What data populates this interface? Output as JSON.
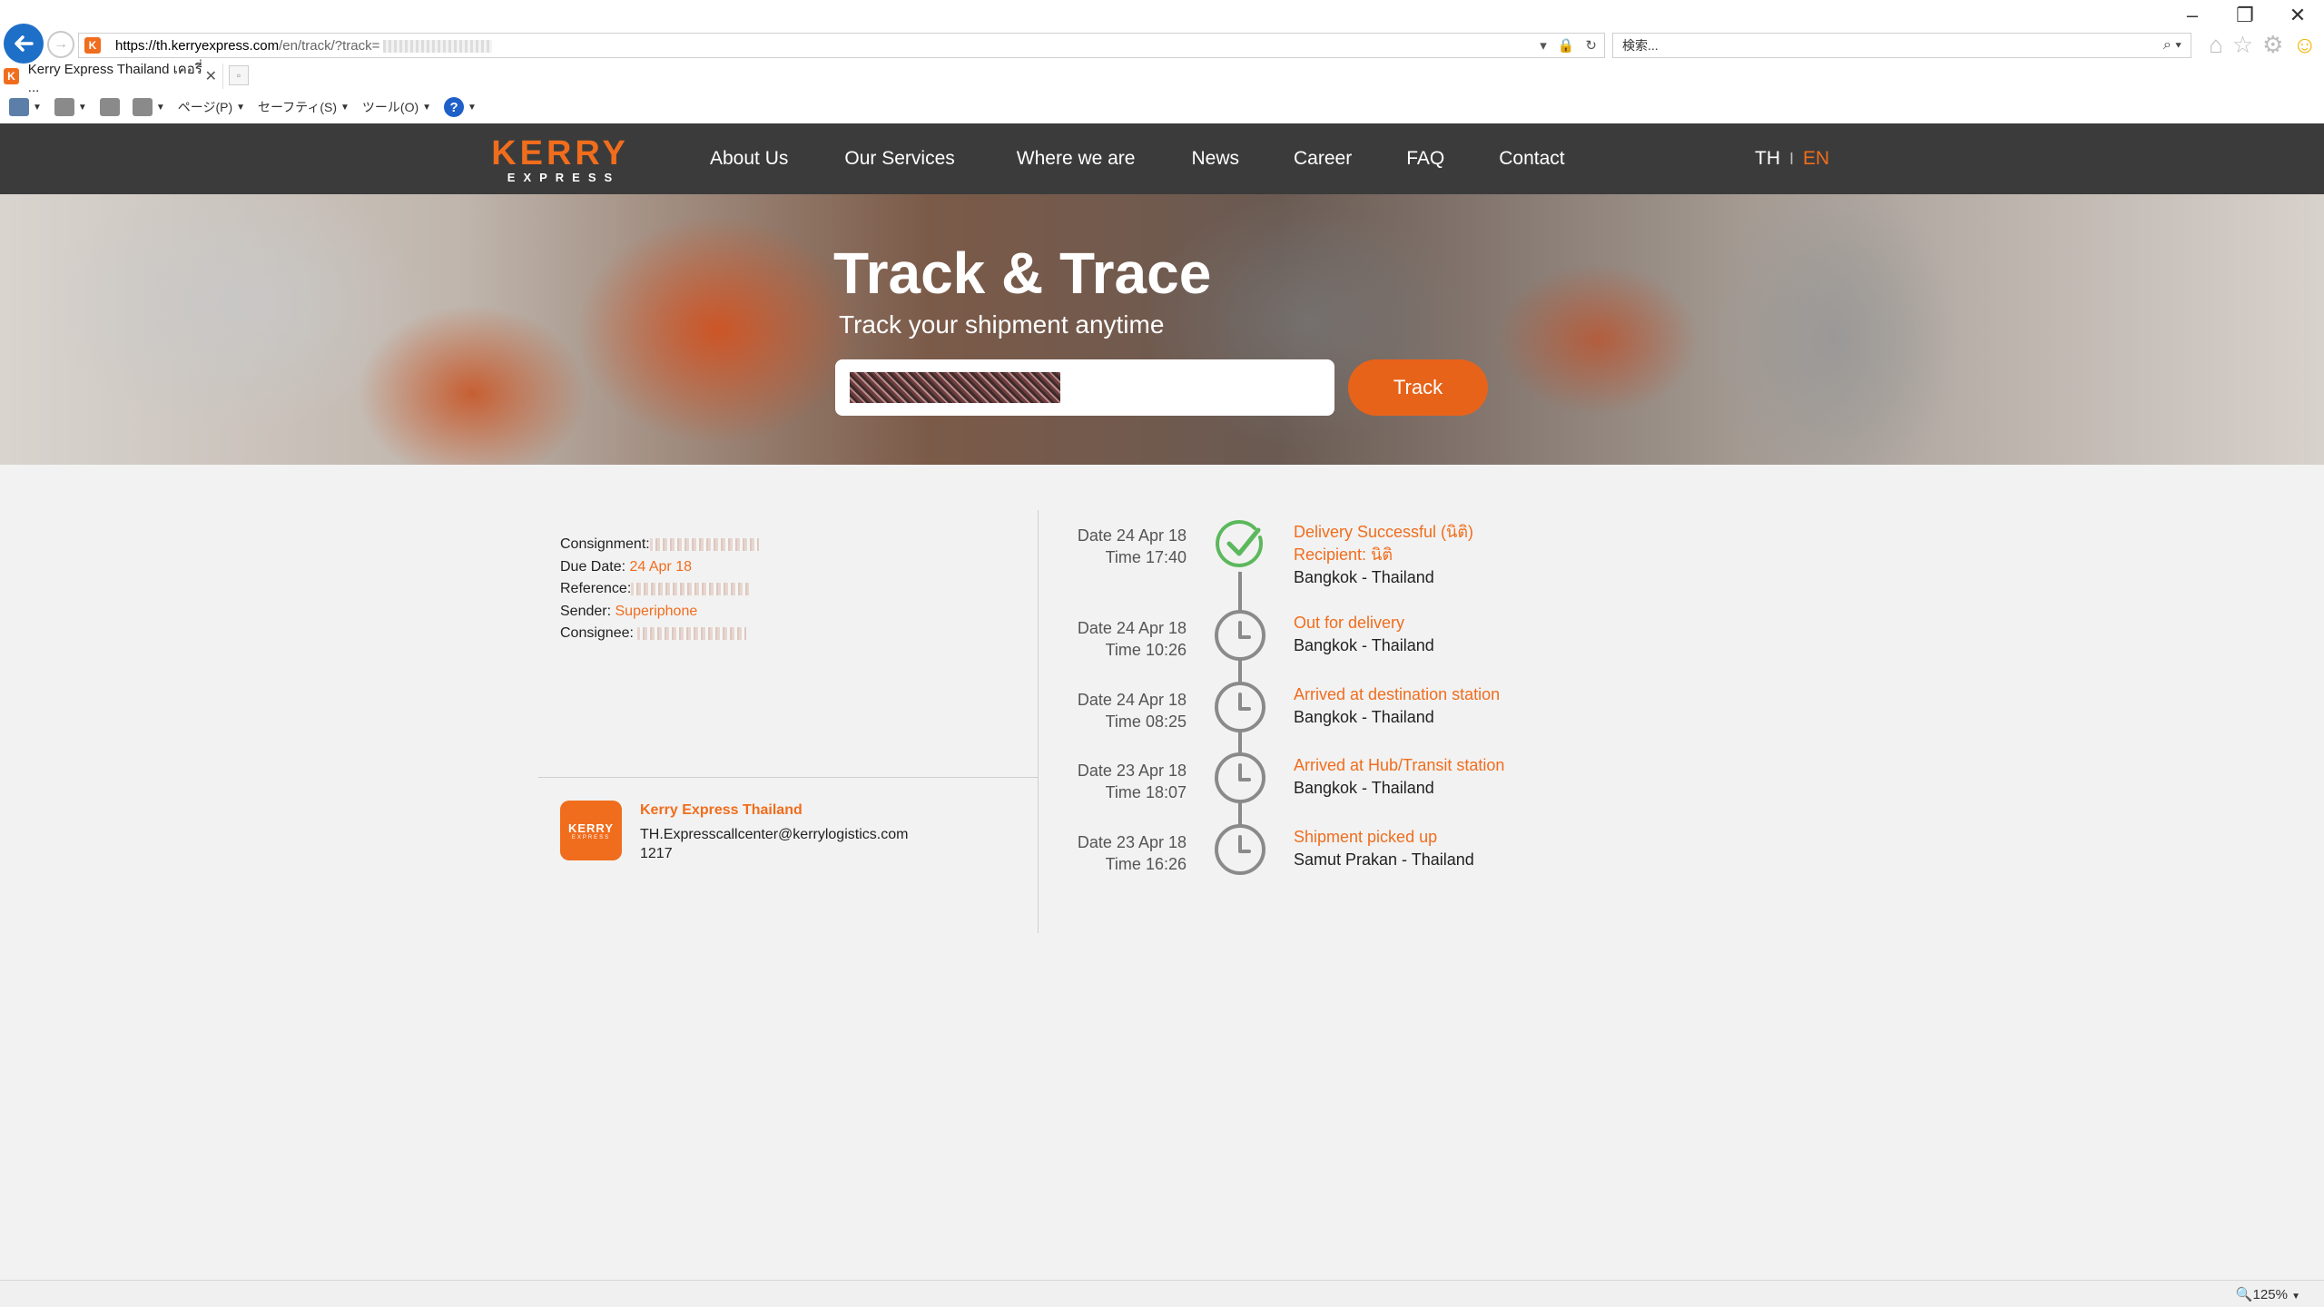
{
  "browser": {
    "url_host": "https://th.kerryexpress.com",
    "url_path": "/en/track/?track=",
    "search_placeholder": "検索...",
    "tab_title": "Kerry Express Thailand เคอรี่ ...",
    "tab_favicon": "K",
    "window_minimize": "–",
    "window_restore": "❐",
    "window_close": "✕",
    "cmd": {
      "page": "ページ(P)",
      "safety": "セーフティ(S)",
      "tools": "ツール(O)",
      "help": "?"
    },
    "zoom": "🔍125%"
  },
  "nav": {
    "logo_main": "KERRY",
    "logo_sub": "EXPRESS",
    "items": [
      "About Us",
      "Our Services",
      "Where we are",
      "News",
      "Career",
      "FAQ",
      "Contact"
    ],
    "lang_th": "TH",
    "lang_sep": "I",
    "lang_en": "EN"
  },
  "hero": {
    "title": "Track & Trace",
    "subtitle": "Track your shipment anytime",
    "button": "Track"
  },
  "details": {
    "consignment_label": "Consignment:",
    "due_label": "Due Date:",
    "due_value": "24 Apr 18",
    "reference_label": "Reference:",
    "sender_label": "Sender:",
    "sender_value": "Superiphone",
    "consignee_label": "Consignee:"
  },
  "contact": {
    "logo_main": "KERRY",
    "logo_sub": "EXPRESS",
    "name": "Kerry Express Thailand",
    "email": "TH.Expresscallcenter@kerrylogistics.com",
    "phone": "1217"
  },
  "timeline": [
    {
      "date": "Date 24 Apr 18",
      "time": "Time 17:40",
      "status": "Delivery Successful (นิติ)",
      "extra": "Recipient: นิติ",
      "location": "Bangkok - Thailand",
      "icon": "check-icon"
    },
    {
      "date": "Date 24 Apr 18",
      "time": "Time 10:26",
      "status": "Out for delivery",
      "extra": "",
      "location": "Bangkok - Thailand",
      "icon": "clock-icon"
    },
    {
      "date": "Date 24 Apr 18",
      "time": "Time 08:25",
      "status": "Arrived at destination station",
      "extra": "",
      "location": "Bangkok - Thailand",
      "icon": "clock-icon"
    },
    {
      "date": "Date 23 Apr 18",
      "time": "Time 18:07",
      "status": "Arrived at Hub/Transit station",
      "extra": "",
      "location": "Bangkok - Thailand",
      "icon": "clock-icon"
    },
    {
      "date": "Date 23 Apr 18",
      "time": "Time 16:26",
      "status": "Shipment picked up",
      "extra": "",
      "location": "Samut Prakan - Thailand",
      "icon": "clock-icon"
    }
  ],
  "colors": {
    "brand_orange": "#f06d1d",
    "nav_bg": "#3b3b3b",
    "success_green": "#5cb85c",
    "timeline_gray": "#8a8a8a"
  }
}
